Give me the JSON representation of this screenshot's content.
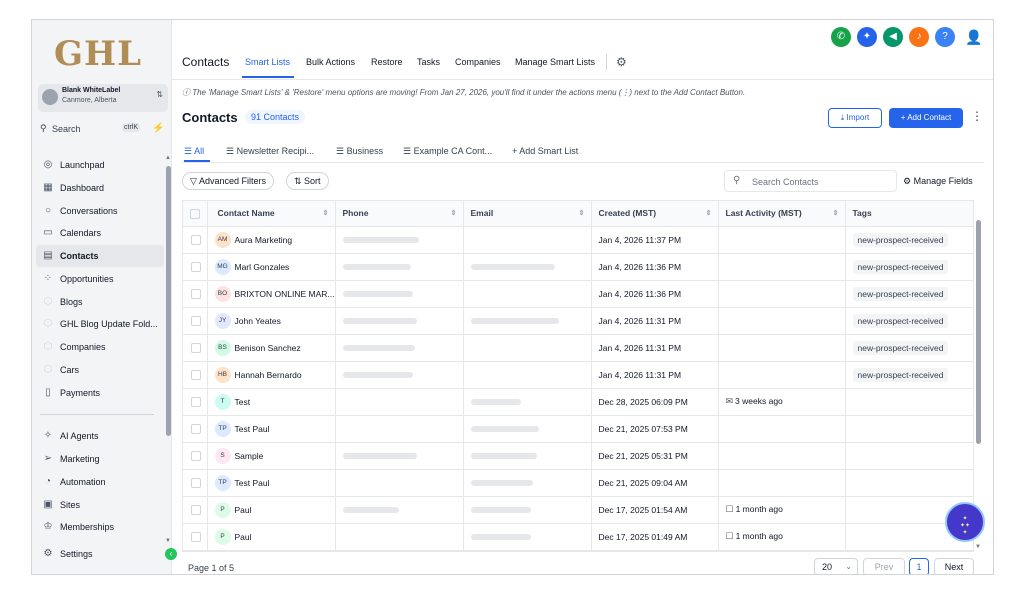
{
  "app": {
    "logo": "GHL"
  },
  "account": {
    "name": "Blank WhiteLabel",
    "location": "Canmore, Alberta"
  },
  "sidebar": {
    "search_placeholder": "Search",
    "search_shortcut": "ctrlK",
    "items": [
      {
        "label": "Launchpad",
        "icon": "rocket-icon",
        "glyph": "◎"
      },
      {
        "label": "Dashboard",
        "icon": "dashboard-icon",
        "glyph": "▦"
      },
      {
        "label": "Conversations",
        "icon": "chat-icon",
        "glyph": "○"
      },
      {
        "label": "Calendars",
        "icon": "calendar-icon",
        "glyph": "▭"
      },
      {
        "label": "Contacts",
        "icon": "contacts-icon",
        "glyph": "▤"
      },
      {
        "label": "Opportunities",
        "icon": "opportunities-icon",
        "glyph": "⁘"
      },
      {
        "label": "Blogs",
        "icon": "cube-icon",
        "glyph": "⬡"
      },
      {
        "label": "GHL Blog Update Fold...",
        "icon": "cube-icon",
        "glyph": "⬡"
      },
      {
        "label": "Companies",
        "icon": "cube-icon",
        "glyph": "⬡"
      },
      {
        "label": "Cars",
        "icon": "cube-icon",
        "glyph": "⬡"
      },
      {
        "label": "Payments",
        "icon": "payments-icon",
        "glyph": "▯"
      },
      {
        "label": "AI Agents",
        "icon": "ai-agents-icon",
        "glyph": "✧"
      },
      {
        "label": "Marketing",
        "icon": "marketing-icon",
        "glyph": "➢"
      },
      {
        "label": "Automation",
        "icon": "automation-icon",
        "glyph": "◔"
      },
      {
        "label": "Sites",
        "icon": "sites-icon",
        "glyph": "▣"
      },
      {
        "label": "Memberships",
        "icon": "memberships-icon",
        "glyph": "♔"
      },
      {
        "label": "Settings",
        "icon": "gear-icon",
        "glyph": "⚙"
      }
    ]
  },
  "topnav": {
    "tabs": [
      "Contacts",
      "Smart Lists",
      "Bulk Actions",
      "Restore",
      "Tasks",
      "Companies",
      "Manage Smart Lists"
    ],
    "active_tab": "Smart Lists",
    "icons": [
      {
        "name": "phone-icon",
        "glyph": "✆",
        "color": "#16a34a"
      },
      {
        "name": "sparkle-icon",
        "glyph": "✦",
        "color": "#2563eb"
      },
      {
        "name": "megaphone-icon",
        "glyph": "◀",
        "color": "#059669"
      },
      {
        "name": "bell-icon",
        "glyph": "♪",
        "color": "#f97316"
      },
      {
        "name": "help-icon",
        "glyph": "?",
        "color": "#3b82f6"
      }
    ]
  },
  "banner": "ⓘ The 'Manage Smart Lists' & 'Restore' menu options are moving! From Jan 27, 2026, you'll find it under the actions menu (⋮) next to the Add Contact Button.",
  "header": {
    "title": "Contacts",
    "count": "91 Contacts",
    "import_label": "Import",
    "add_label": "Add Contact"
  },
  "smart_lists": [
    "All",
    "Newsletter Recipi...",
    "Business",
    "Example CA Cont..."
  ],
  "add_smart_list": "Add Smart List",
  "filters": {
    "advanced": "Advanced Filters",
    "sort": "Sort",
    "search_placeholder": "Search Contacts",
    "manage_fields": "Manage Fields"
  },
  "table": {
    "columns": [
      "Contact Name",
      "Phone",
      "Email",
      "Created (MST)",
      "Last Activity (MST)",
      "Tags"
    ],
    "rows": [
      {
        "initials": "AM",
        "color": "#fde2c8",
        "name": "Aura Marketing",
        "phone": true,
        "email": false,
        "created": "Jan 4, 2026 11:37 PM",
        "activity": "",
        "activity_icon": "",
        "tag": "new-prospect-received"
      },
      {
        "initials": "MG",
        "color": "#dbeafe",
        "name": "Marl Gonzales",
        "phone": true,
        "email": true,
        "created": "Jan 4, 2026 11:36 PM",
        "activity": "",
        "activity_icon": "",
        "tag": "new-prospect-received"
      },
      {
        "initials": "BO",
        "color": "#fde2e2",
        "name": "BRIXTON ONLINE MAR...",
        "phone": true,
        "email": false,
        "created": "Jan 4, 2026 11:36 PM",
        "activity": "",
        "activity_icon": "",
        "tag": "new-prospect-received"
      },
      {
        "initials": "JY",
        "color": "#e0e7ff",
        "name": "John Yeates",
        "phone": true,
        "email": true,
        "created": "Jan 4, 2026 11:31 PM",
        "activity": "",
        "activity_icon": "",
        "tag": "new-prospect-received"
      },
      {
        "initials": "BS",
        "color": "#d1fae5",
        "name": "Benison Sanchez",
        "phone": true,
        "email": false,
        "created": "Jan 4, 2026 11:31 PM",
        "activity": "",
        "activity_icon": "",
        "tag": "new-prospect-received"
      },
      {
        "initials": "HB",
        "color": "#fde2c8",
        "name": "Hannah Bernardo",
        "phone": true,
        "email": false,
        "created": "Jan 4, 2026 11:31 PM",
        "activity": "",
        "activity_icon": "",
        "tag": "new-prospect-received"
      },
      {
        "initials": "T",
        "color": "#ccfbf1",
        "name": "Test",
        "phone": false,
        "email": true,
        "created": "Dec 28, 2025 06:09 PM",
        "activity": "3 weeks ago",
        "activity_icon": "✉",
        "tag": ""
      },
      {
        "initials": "TP",
        "color": "#dbeafe",
        "name": "Test Paul",
        "phone": false,
        "email": true,
        "created": "Dec 21, 2025 07:53 PM",
        "activity": "",
        "activity_icon": "",
        "tag": ""
      },
      {
        "initials": "S",
        "color": "#fce7f3",
        "name": "Sample",
        "phone": true,
        "email": true,
        "created": "Dec 21, 2025 05:31 PM",
        "activity": "",
        "activity_icon": "",
        "tag": ""
      },
      {
        "initials": "TP",
        "color": "#dbeafe",
        "name": "Test Paul",
        "phone": false,
        "email": true,
        "created": "Dec 21, 2025 09:04 AM",
        "activity": "",
        "activity_icon": "",
        "tag": ""
      },
      {
        "initials": "P",
        "color": "#dcfce7",
        "name": "Paul",
        "phone": true,
        "email": true,
        "created": "Dec 17, 2025 01:54 AM",
        "activity": "1 month ago",
        "activity_icon": "☐",
        "tag": ""
      },
      {
        "initials": "P",
        "color": "#dcfce7",
        "name": "Paul",
        "phone": false,
        "email": true,
        "created": "Dec 17, 2025 01:49 AM",
        "activity": "1 month ago",
        "activity_icon": "☐",
        "tag": ""
      }
    ]
  },
  "pagination": {
    "page_info": "Page 1 of 5",
    "per_page": "20",
    "prev": "Prev",
    "current": "1",
    "next": "Next"
  }
}
